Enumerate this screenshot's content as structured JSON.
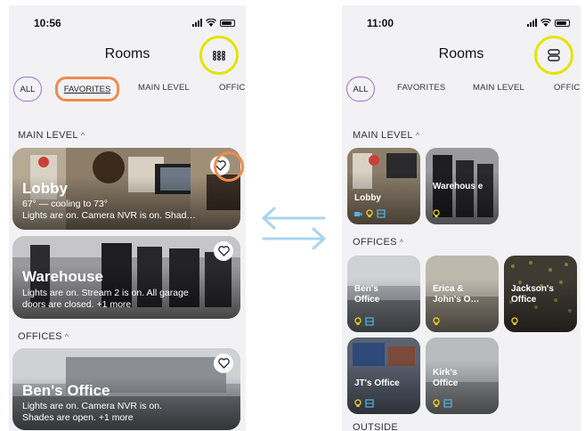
{
  "left": {
    "status": {
      "time": "10:56"
    },
    "title": "Rooms",
    "tabs": {
      "all": "ALL",
      "favorites": "FAVORITES",
      "main": "MAIN LEVEL",
      "offices": "OFFIC"
    },
    "sections": {
      "main": "MAIN LEVEL",
      "offices": "OFFICES"
    },
    "cards": [
      {
        "name": "Lobby",
        "temp": "67° — cooling to 73°",
        "desc": "Lights are on. Camera NVR is on. Shad…"
      },
      {
        "name": "Warehouse",
        "desc1": "Lights are on. Stream 2 is on. All garage",
        "desc2": "doors are closed. +1 more"
      },
      {
        "name": "Ben's Office",
        "desc1": "Lights are on. Camera NVR is on.",
        "desc2": "Shades are open. +1 more"
      }
    ]
  },
  "right": {
    "status": {
      "time": "11:00"
    },
    "title": "Rooms",
    "tabs": {
      "all": "ALL",
      "favorites": "FAVORITES",
      "main": "MAIN LEVEL",
      "offices": "OFFIC"
    },
    "sections": {
      "main": "MAIN LEVEL",
      "offices": "OFFICES",
      "outside": "OUTSIDE"
    },
    "tiles": {
      "lobby": "Lobby",
      "warehouse": "Warehous e",
      "bens": "Ben's Office",
      "erica": "Erica & John's O…",
      "jackson": "Jackson's Office",
      "jt": "JT's Office",
      "kirk": "Kirk's Office"
    }
  },
  "colors": {
    "highlight_yellow": "#e2e400",
    "highlight_orange": "#f28a4c",
    "arrow_blue": "#a9d4ee",
    "tab_all_border": "#9a6cd0"
  },
  "icons": [
    "grid-view-icon",
    "list-view-icon",
    "heart-icon",
    "swap-arrows-icon",
    "bulb-icon",
    "shade-icon",
    "camera-icon"
  ]
}
